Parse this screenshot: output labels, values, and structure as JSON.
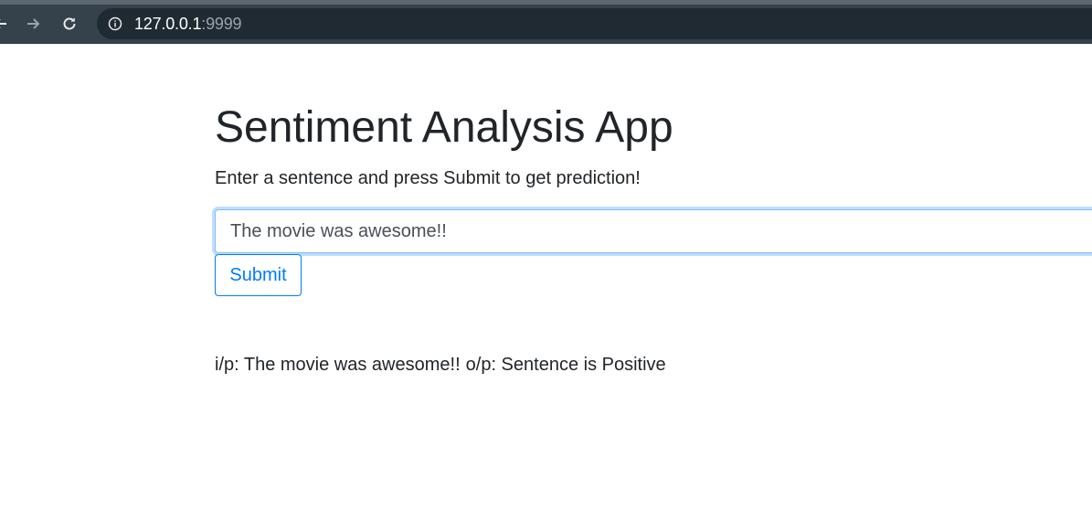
{
  "browser": {
    "url_host": "127.0.0.1",
    "url_port": ":9999"
  },
  "app": {
    "title": "Sentiment Analysis App",
    "instruction": "Enter a sentence and press Submit to get prediction!",
    "input_value": "The movie was awesome!!",
    "submit_label": "Submit",
    "result_input_label": "i/p: The movie was awesome!!",
    "result_output_label": "o/p: Sentence is Positive"
  },
  "colors": {
    "accent": "#007bff",
    "text": "#212529",
    "toolbar": "#35414b",
    "omnibox": "#202a32"
  }
}
